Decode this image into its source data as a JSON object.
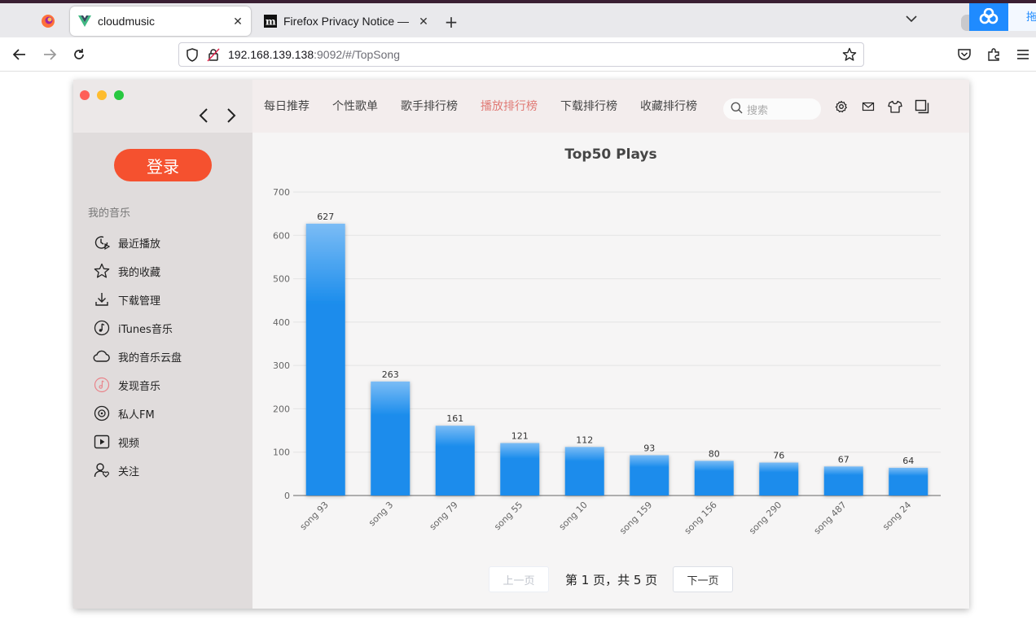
{
  "browser": {
    "tabs": [
      {
        "title": "cloudmusic",
        "active": true,
        "favicon": "vue-icon"
      },
      {
        "title": "Firefox Privacy Notice —",
        "active": false,
        "favicon": "mozilla-m-icon"
      }
    ],
    "url_host": "192.168.139.138",
    "url_rest": ":9092/#/TopSong",
    "extension_text": "拖"
  },
  "sidebar": {
    "login_label": "登录",
    "section_title": "我的音乐",
    "items": [
      {
        "label": "最近播放",
        "icon": "recent-clock-icon"
      },
      {
        "label": "我的收藏",
        "icon": "star-icon"
      },
      {
        "label": "下载管理",
        "icon": "download-icon"
      },
      {
        "label": "iTunes音乐",
        "icon": "music-note-icon"
      },
      {
        "label": "我的音乐云盘",
        "icon": "cloud-icon"
      },
      {
        "label": "发现音乐",
        "icon": "discover-music-icon"
      },
      {
        "label": "私人FM",
        "icon": "radio-disc-icon"
      },
      {
        "label": "视频",
        "icon": "video-play-icon"
      },
      {
        "label": "关注",
        "icon": "follow-user-icon"
      }
    ]
  },
  "header": {
    "tabs": [
      "每日推荐",
      "个性歌单",
      "歌手排行榜",
      "播放排行榜",
      "下载排行榜",
      "收藏排行榜"
    ],
    "active_tab": "播放排行榜",
    "search_placeholder": "搜索"
  },
  "chart_data": {
    "type": "bar",
    "title": "Top50 Plays",
    "categories": [
      "song 93",
      "song 3",
      "song 79",
      "song 55",
      "song 10",
      "song 159",
      "song 156",
      "song 290",
      "song 487",
      "song 24"
    ],
    "values": [
      627,
      263,
      161,
      121,
      112,
      93,
      80,
      76,
      67,
      64
    ],
    "ylim": [
      0,
      700
    ],
    "yticks": [
      0,
      100,
      200,
      300,
      400,
      500,
      600,
      700
    ],
    "grid": true,
    "bar_color_top": "#7bbcf5",
    "bar_color": "#1a8cec"
  },
  "pager": {
    "prev_label": "上一页",
    "info": "第 1 页，共 5 页",
    "next_label": "下一页"
  },
  "colors": {
    "accent": "#f5512f",
    "active_tab": "#e07a75"
  }
}
